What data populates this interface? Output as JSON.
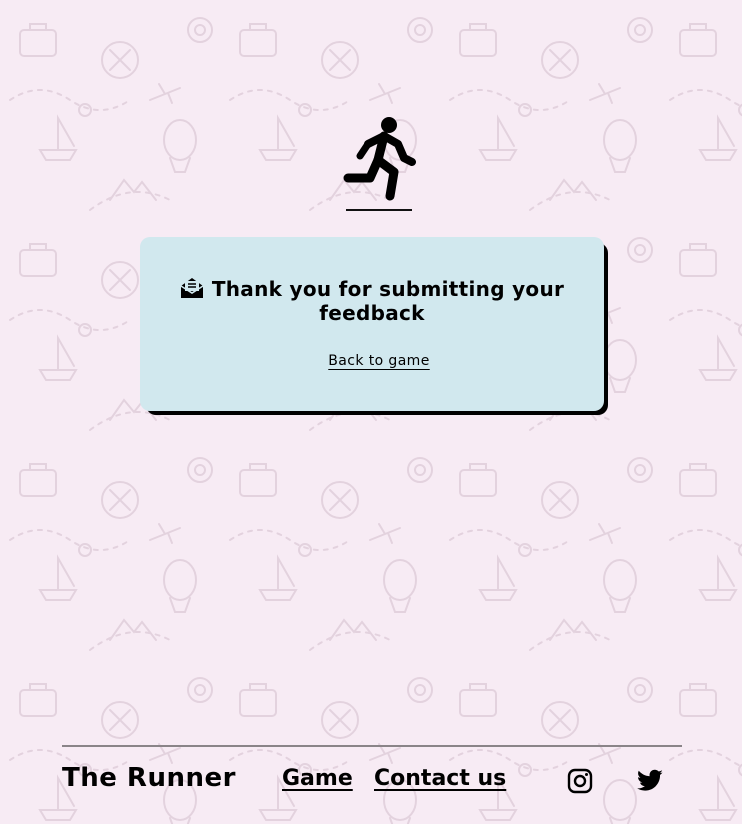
{
  "card": {
    "message": "Thank you for submitting your feedback",
    "back_link": "Back to game"
  },
  "footer": {
    "brand": "The Runner",
    "nav": {
      "game": "Game",
      "contact": "Contact us"
    }
  },
  "icons": {
    "logo": "running-person-icon",
    "message": "envelope-open-icon",
    "social": [
      "instagram-icon",
      "twitter-icon"
    ]
  },
  "colors": {
    "page_background": "#f7ebf4",
    "card_background": "#d1e8ee",
    "card_shadow": "#000000",
    "text": "#000000"
  }
}
